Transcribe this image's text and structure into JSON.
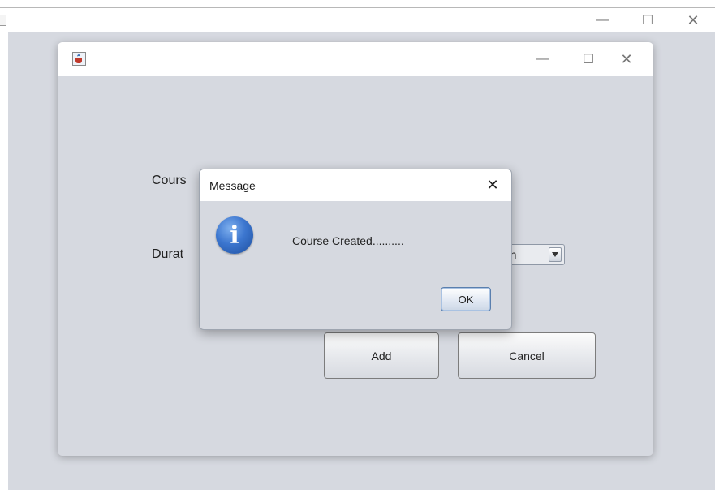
{
  "outer_window": {
    "controls": {
      "minimize": "—",
      "maximize": "☐",
      "close": "✕"
    }
  },
  "inner_window": {
    "controls": {
      "minimize": "—",
      "maximize": "☐",
      "close": "✕"
    },
    "form": {
      "course_label_visible": "Cours",
      "duration_label_visible": "Durat",
      "duration_select_visible_text": "nth",
      "add_button": "Add",
      "cancel_button": "Cancel"
    }
  },
  "dialog": {
    "title": "Message",
    "close": "✕",
    "message": "Course Created..........",
    "ok_button": "OK"
  },
  "colors": {
    "window_background": "#d6d9e0",
    "titlebar": "#ffffff",
    "info_icon": "#3c76cf"
  }
}
